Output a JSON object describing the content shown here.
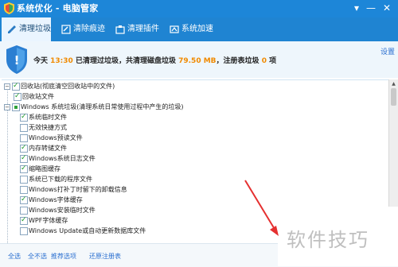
{
  "window": {
    "title": "系统优化 - 电脑管家",
    "controls": [
      "▾",
      "—",
      "✕"
    ]
  },
  "tabs": [
    {
      "label": "清理垃圾",
      "icon": "broom-icon",
      "active": true
    },
    {
      "label": "清除痕迹",
      "icon": "eraser-icon",
      "active": false
    },
    {
      "label": "清理插件",
      "icon": "plugin-icon",
      "active": false
    },
    {
      "label": "系统加速",
      "icon": "rocket-icon",
      "active": false
    }
  ],
  "header": {
    "summary_prefix": "今天",
    "time": "13:30",
    "summary_mid": "已清理过垃圾，共清理磁盘垃圾",
    "size": "79.50 MB",
    "summary_mid2": "，注册表垃圾",
    "reg_count": "0",
    "summary_suffix": "项",
    "settings_link": "设置"
  },
  "tree": [
    {
      "label": "回收站(彻底清空回收站中的文件)",
      "level": 0,
      "state": "checked",
      "expanded": true
    },
    {
      "label": "回收站文件",
      "level": 1,
      "state": "checked"
    },
    {
      "label": "Windows 系统垃圾(清理系统日常使用过程中产生的垃圾)",
      "level": 0,
      "state": "partial",
      "expanded": true
    },
    {
      "label": "系统临时文件",
      "level": 1,
      "state": "checked"
    },
    {
      "label": "无效快捷方式",
      "level": 1,
      "state": "unchecked"
    },
    {
      "label": "Windows预读文件",
      "level": 1,
      "state": "unchecked"
    },
    {
      "label": "内存转储文件",
      "level": 1,
      "state": "checked"
    },
    {
      "label": "Windows系统日志文件",
      "level": 1,
      "state": "checked"
    },
    {
      "label": "缩略图缓存",
      "level": 1,
      "state": "checked"
    },
    {
      "label": "系统已下载的程序文件",
      "level": 1,
      "state": "unchecked"
    },
    {
      "label": "Windows打补丁时留下的卸载信息",
      "level": 1,
      "state": "unchecked"
    },
    {
      "label": "Windows字体缓存",
      "level": 1,
      "state": "checked"
    },
    {
      "label": "Windows安装临时文件",
      "level": 1,
      "state": "unchecked"
    },
    {
      "label": "WPF字体缓存",
      "level": 1,
      "state": "checked"
    },
    {
      "label": "Windows Update或自动更新数据库文件",
      "level": 1,
      "state": "unchecked"
    }
  ],
  "footer": {
    "select_all": "全选",
    "select_none": "全不选",
    "recommend": "推荐选项",
    "restore": "还原注册表"
  },
  "watermark": "软件技巧",
  "colors": {
    "titlebar": "#1d86d8",
    "tabbar": "#1f84d2",
    "highlight": "#f08a00",
    "link": "#2a6fd0",
    "arrow": "#e53030"
  }
}
